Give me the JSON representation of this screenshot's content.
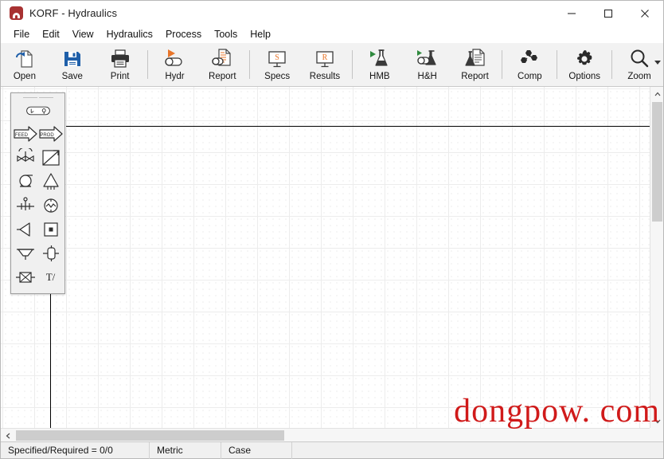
{
  "window": {
    "title": "KORF - Hydraulics",
    "app_icon": "korf-arch-icon",
    "controls": {
      "minimize": "minimize-icon",
      "maximize": "maximize-icon",
      "close": "close-icon"
    }
  },
  "menubar": {
    "items": [
      {
        "label": "File"
      },
      {
        "label": "Edit"
      },
      {
        "label": "View"
      },
      {
        "label": "Hydraulics"
      },
      {
        "label": "Process"
      },
      {
        "label": "Tools"
      },
      {
        "label": "Help"
      }
    ]
  },
  "toolbar": {
    "buttons": [
      {
        "label": "Open",
        "icon": "open-folder-document-icon"
      },
      {
        "label": "Save",
        "icon": "floppy-disk-icon"
      },
      {
        "label": "Print",
        "icon": "printer-icon"
      },
      {
        "label": "Hydr",
        "icon": "hydraulics-run-icon"
      },
      {
        "label": "Report",
        "icon": "hydraulics-report-icon"
      },
      {
        "label": "Specs",
        "icon": "specs-monitor-icon"
      },
      {
        "label": "Results",
        "icon": "results-monitor-icon"
      },
      {
        "label": "HMB",
        "icon": "flask-run-icon"
      },
      {
        "label": "H&H",
        "icon": "flask-cylinder-run-icon"
      },
      {
        "label": "Report",
        "icon": "flask-report-icon"
      },
      {
        "label": "Comp",
        "icon": "components-molecule-icon"
      },
      {
        "label": "Options",
        "icon": "gear-icon"
      },
      {
        "label": "Zoom",
        "icon": "magnifier-icon"
      }
    ],
    "zoom_dropdown": "chevron-down-icon"
  },
  "palette": {
    "grip": "drag-grip",
    "items": [
      {
        "name": "horizontal-drum-vessel",
        "icon": "drum-icon"
      },
      {
        "name": "feed-stream",
        "icon": "feed-arrow-icon",
        "text": "FEED"
      },
      {
        "name": "product-stream",
        "icon": "product-arrow-icon",
        "text": "PROD"
      },
      {
        "name": "control-valve",
        "icon": "control-valve-icon"
      },
      {
        "name": "heat-exchanger",
        "icon": "heat-exchanger-icon"
      },
      {
        "name": "centrifugal-pump",
        "icon": "pump-icon"
      },
      {
        "name": "column-tower",
        "icon": "column-icon"
      },
      {
        "name": "tee-mixer",
        "icon": "tee-mixer-icon"
      },
      {
        "name": "flow-meter",
        "icon": "flow-meter-icon"
      },
      {
        "name": "compressor",
        "icon": "compressor-icon"
      },
      {
        "name": "block-unit",
        "icon": "block-icon"
      },
      {
        "name": "hopper",
        "icon": "hopper-icon"
      },
      {
        "name": "vertical-vessel",
        "icon": "vertical-vessel-icon"
      },
      {
        "name": "crossed-box",
        "icon": "crossed-box-icon"
      },
      {
        "name": "text-annotation",
        "icon": "text-tool",
        "text": "T/"
      }
    ]
  },
  "canvas": {
    "grid": "dot-grid",
    "objects": [
      {
        "name": "horizontal-pipe-line",
        "type": "line"
      },
      {
        "name": "vertical-pipe-line",
        "type": "line"
      }
    ]
  },
  "scrollbars": {
    "vertical": {
      "up": "chevron-up-icon",
      "down": "chevron-down-icon"
    },
    "horizontal": {
      "left": "chevron-left-icon",
      "right": "chevron-right-icon"
    }
  },
  "statusbar": {
    "specified": "Specified/Required = 0/0",
    "units": "Metric",
    "case": "Case"
  },
  "watermark": {
    "text": "dongpow. com",
    "color": "#d01a1a"
  },
  "colors": {
    "accent_blue": "#1f5fa9",
    "accent_orange": "#e8752a",
    "accent_green": "#2f8a3e",
    "toolbar_bg": "#f2f2f2",
    "titlebar_bg": "#ffffff"
  }
}
